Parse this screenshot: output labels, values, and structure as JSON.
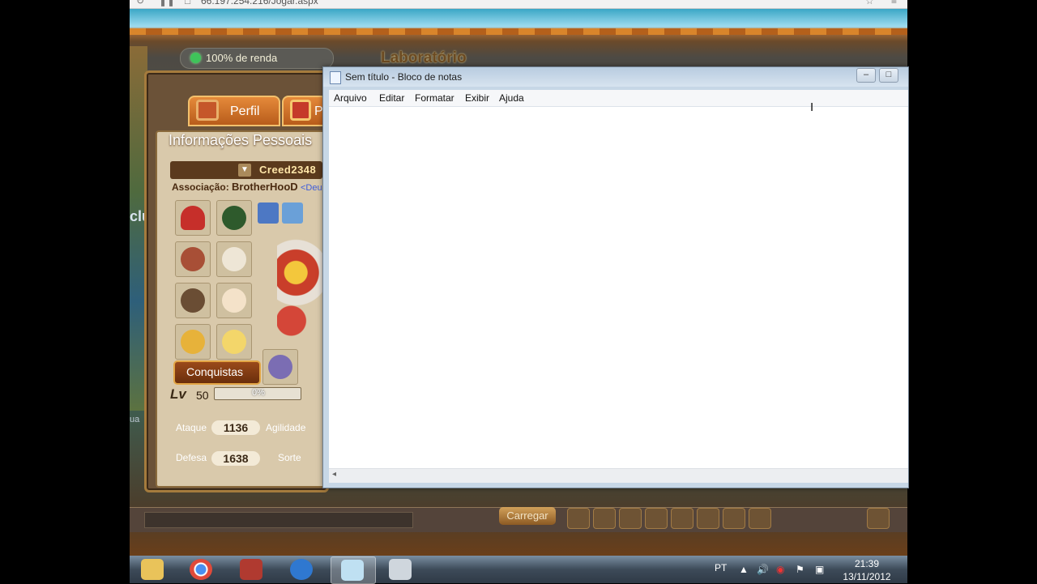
{
  "browser": {
    "url": "66.197.254.216/Jogar.aspx"
  },
  "game": {
    "income_label": "100% de renda",
    "location_title": "Laboratório",
    "tabs": [
      "Perfil",
      "P"
    ],
    "info_title": "Informações Pessoais",
    "player_name": "Creed2348",
    "association_label": "Associação:",
    "association_name": "BrotherHooD",
    "association_tag": "<Deu",
    "conquests_label": "Conquistas",
    "level_label": "Lv",
    "level": "50",
    "exp_progress": "0%",
    "stats": {
      "attack_label": "Ataque",
      "attack_value": "1136",
      "agility_label": "Agilidade",
      "defense_label": "Defesa",
      "defense_value": "1638",
      "luck_label": "Sorte"
    },
    "load_button": "Carregar",
    "side_text_1": "clu",
    "side_text_2": "ua"
  },
  "notepad": {
    "title": "Sem título - Bloco de notas",
    "menu": [
      "Arquivo",
      "Editar",
      "Formatar",
      "Exibir",
      "Ajuda"
    ],
    "content": ""
  },
  "taskbar": {
    "apps": [
      "file-explorer-icon",
      "chrome-icon",
      "crossfire-icon",
      "internet-explorer-icon",
      "notepad-icon",
      "camera-icon"
    ],
    "language": "PT",
    "time": "21:39",
    "date": "13/11/2012"
  },
  "colors": {
    "taskbar": "#3d4b59",
    "notepad_title": "#c7d7e6",
    "game_orange": "#d9852b"
  }
}
